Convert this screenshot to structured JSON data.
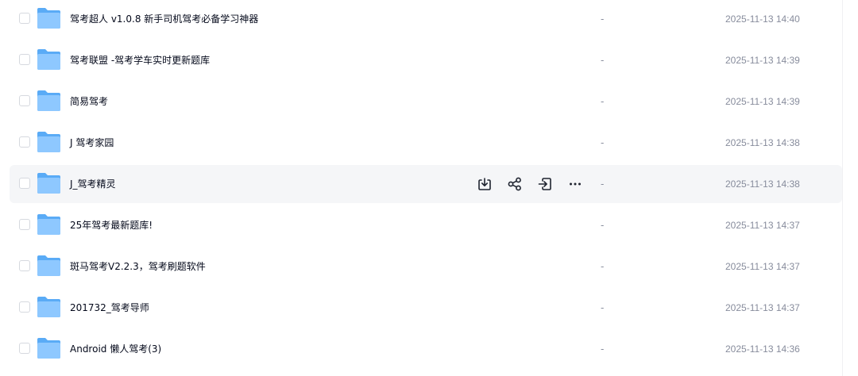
{
  "colors": {
    "folder_back": "#5aabf6",
    "folder_front": "#8ec8ff",
    "text_primary": "#03081a",
    "text_secondary": "#878c9c",
    "hover_bg": "#f5f6f8"
  },
  "row_actions": [
    {
      "icon": "download-icon"
    },
    {
      "icon": "share-icon"
    },
    {
      "icon": "move-to-icon"
    },
    {
      "icon": "more-icon"
    }
  ],
  "files": [
    {
      "name": "驾考超人 v1.0.8 新手司机驾考必备学习神器",
      "size": "-",
      "modified": "2025-11-13 14:40"
    },
    {
      "name": "驾考联盟 -驾考学车实时更新题库",
      "size": "-",
      "modified": "2025-11-13 14:39"
    },
    {
      "name": "简易驾考",
      "size": "-",
      "modified": "2025-11-13 14:39"
    },
    {
      "name": "J 驾考家园",
      "size": "-",
      "modified": "2025-11-13 14:38"
    },
    {
      "name": "J_驾考精灵",
      "size": "-",
      "modified": "2025-11-13 14:38",
      "hovered": true
    },
    {
      "name": "25年驾考最新题库!",
      "size": "-",
      "modified": "2025-11-13 14:37"
    },
    {
      "name": "斑马驾考V2.2.3，驾考刷题软件",
      "size": "-",
      "modified": "2025-11-13 14:37"
    },
    {
      "name": "201732_驾考导师",
      "size": "-",
      "modified": "2025-11-13 14:37"
    },
    {
      "name": "Android 懒人驾考(3)",
      "size": "-",
      "modified": "2025-11-13 14:36"
    }
  ]
}
